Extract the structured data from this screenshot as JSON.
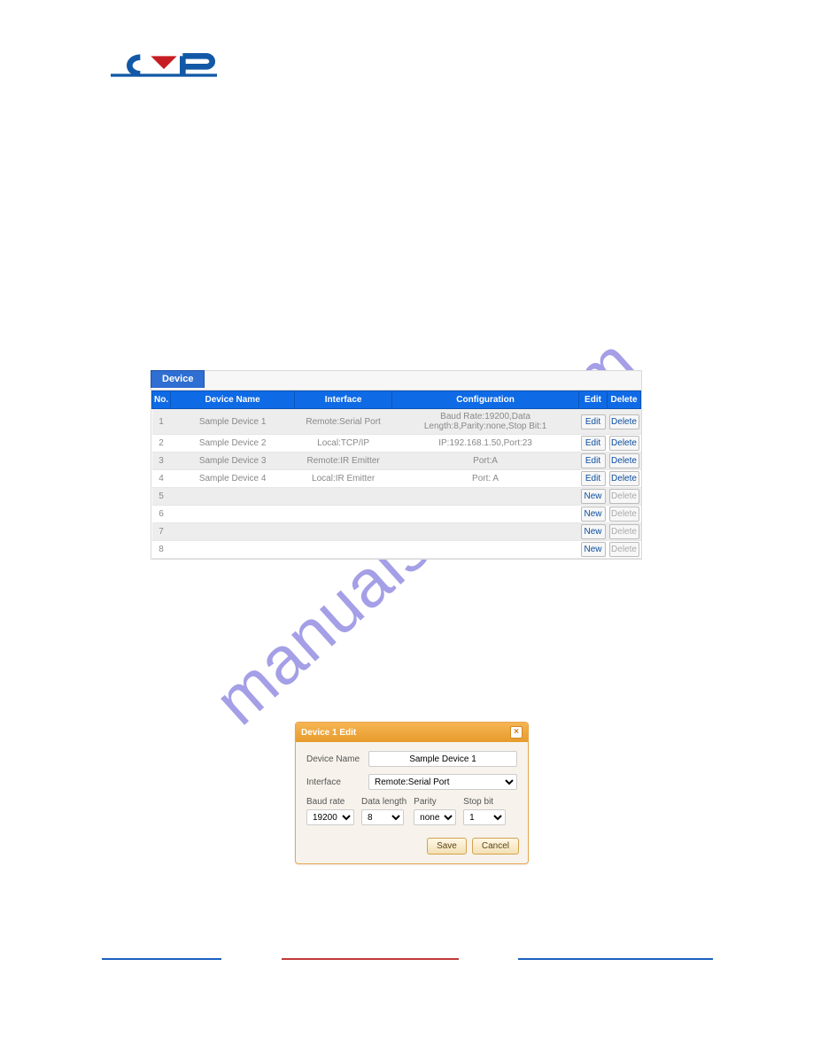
{
  "watermark": "manualshive.com",
  "logo": {
    "brand_name": "CYP"
  },
  "device_panel": {
    "tab_label": "Device",
    "headers": {
      "no": "No.",
      "name": "Device Name",
      "iface": "Interface",
      "conf": "Configuration",
      "edit": "Edit",
      "del": "Delete"
    },
    "rows": [
      {
        "no": "1",
        "name": "Sample Device 1",
        "iface": "Remote:Serial Port",
        "conf": "Baud Rate:19200,Data Length:8,Parity:none,Stop Bit:1",
        "edit": "Edit",
        "del": "Delete",
        "del_enabled": true
      },
      {
        "no": "2",
        "name": "Sample Device 2",
        "iface": "Local:TCP/IP",
        "conf": "IP:192.168.1.50,Port:23",
        "edit": "Edit",
        "del": "Delete",
        "del_enabled": true
      },
      {
        "no": "3",
        "name": "Sample Device 3",
        "iface": "Remote:IR Emitter",
        "conf": "Port:A",
        "edit": "Edit",
        "del": "Delete",
        "del_enabled": true
      },
      {
        "no": "4",
        "name": "Sample Device 4",
        "iface": "Local:IR Emitter",
        "conf": "Port: A",
        "edit": "Edit",
        "del": "Delete",
        "del_enabled": true
      },
      {
        "no": "5",
        "name": "",
        "iface": "",
        "conf": "",
        "edit": "New",
        "del": "Delete",
        "del_enabled": false
      },
      {
        "no": "6",
        "name": "",
        "iface": "",
        "conf": "",
        "edit": "New",
        "del": "Delete",
        "del_enabled": false
      },
      {
        "no": "7",
        "name": "",
        "iface": "",
        "conf": "",
        "edit": "New",
        "del": "Delete",
        "del_enabled": false
      },
      {
        "no": "8",
        "name": "",
        "iface": "",
        "conf": "",
        "edit": "New",
        "del": "Delete",
        "del_enabled": false
      }
    ]
  },
  "edit_dialog": {
    "title": "Device 1 Edit",
    "close_glyph": "×",
    "labels": {
      "device_name": "Device Name",
      "interface": "Interface",
      "baud": "Baud rate",
      "data_len": "Data length",
      "parity": "Parity",
      "stop_bit": "Stop bit"
    },
    "values": {
      "device_name": "Sample Device 1",
      "interface": "Remote:Serial Port",
      "baud": "19200",
      "data_len": "8",
      "parity": "none",
      "stop_bit": "1"
    },
    "buttons": {
      "save": "Save",
      "cancel": "Cancel"
    }
  }
}
